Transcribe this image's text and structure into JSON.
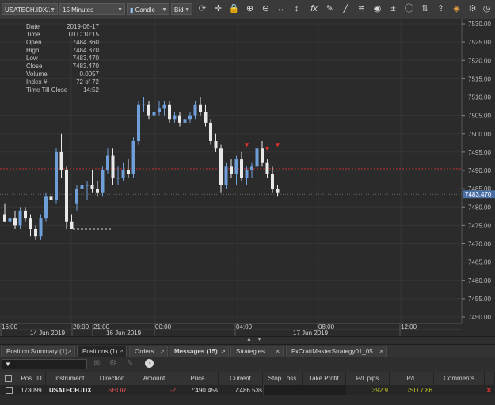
{
  "toolbar": {
    "instrument": "USATECH.IDX/...",
    "timeframe": "15 Minutes",
    "chart_type": "Candle",
    "price_side": "Bid",
    "icons": [
      "refresh-icon",
      "crosshair-icon",
      "lock-icon",
      "zoom-in-icon",
      "zoom-out-icon",
      "horizontal-arrows-icon",
      "vertical-arrows-icon",
      "function-icon",
      "pencil-icon",
      "diagonal-line-icon",
      "layers-icon",
      "eye-icon",
      "plus-minus-icon",
      "info-icon",
      "sell-buy-icon",
      "export-icon",
      "paint-icon",
      "settings-icon"
    ]
  },
  "info_panel": [
    {
      "key": "Date",
      "value": "2019-06-17"
    },
    {
      "key": "Time",
      "value": "UTC 10:15"
    },
    {
      "key": "Open",
      "value": "7484.360"
    },
    {
      "key": "High",
      "value": "7484.370"
    },
    {
      "key": "Low",
      "value": "7483.470"
    },
    {
      "key": "Close",
      "value": "7483.470"
    },
    {
      "key": "Volume",
      "value": "0.0057"
    },
    {
      "key": "Index #",
      "value": "72 of 72"
    },
    {
      "key": "Time Till Close",
      "value": "14:52"
    }
  ],
  "chart_data": {
    "type": "candlestick",
    "ylim": [
      7445,
      7532
    ],
    "y_ticks": [
      "7530.00",
      "7525.00",
      "7520.00",
      "7515.00",
      "7510.00",
      "7505.00",
      "7500.00",
      "7495.00",
      "7490.00",
      "7485.00",
      "7480.00",
      "7475.00",
      "7470.00",
      "7465.00",
      "7460.00",
      "7455.00",
      "7450.00"
    ],
    "current_price_label": "7483.470",
    "position_entry_price": 7490.45,
    "candles_ohlc": [
      [
        7478,
        7481,
        7476,
        7476
      ],
      [
        7476,
        7480,
        7474,
        7477
      ],
      [
        7477,
        7479,
        7474,
        7475
      ],
      [
        7475,
        7480,
        7474,
        7479
      ],
      [
        7479,
        7480,
        7476,
        7477
      ],
      [
        7477,
        7478,
        7472,
        7474
      ],
      [
        7474,
        7475,
        7471,
        7472
      ],
      [
        7472,
        7478,
        7471,
        7477
      ],
      [
        7477,
        7484,
        7476,
        7483
      ],
      [
        7483,
        7490,
        7479,
        7482
      ],
      [
        7482,
        7496,
        7481,
        7495
      ],
      [
        7495,
        7500,
        7488,
        7490
      ],
      [
        7490,
        7491,
        7474,
        7476
      ],
      [
        7476,
        7478,
        7474,
        7474
      ],
      [
        7481,
        7486,
        7479,
        7485
      ],
      [
        7485,
        7488,
        7483,
        7486
      ],
      [
        7486,
        7487,
        7482,
        7486
      ],
      [
        7486,
        7490,
        7484,
        7485
      ],
      [
        7485,
        7487,
        7483,
        7484
      ],
      [
        7484,
        7491,
        7483,
        7490
      ],
      [
        7490,
        7496,
        7489,
        7494
      ],
      [
        7494,
        7496,
        7486,
        7488
      ],
      [
        7488,
        7491,
        7486,
        7488
      ],
      [
        7488,
        7492,
        7487,
        7490
      ],
      [
        7490,
        7493,
        7488,
        7489
      ],
      [
        7489,
        7499,
        7488,
        7498
      ],
      [
        7498,
        7509,
        7497,
        7508
      ],
      [
        7508,
        7510,
        7506,
        7508
      ],
      [
        7508,
        7509,
        7504,
        7505
      ],
      [
        7505,
        7508,
        7503,
        7506
      ],
      [
        7506,
        7509,
        7505,
        7507
      ],
      [
        7507,
        7509,
        7505,
        7508
      ],
      [
        7508,
        7509,
        7503,
        7504
      ],
      [
        7504,
        7506,
        7503,
        7505
      ],
      [
        7505,
        7506,
        7502,
        7503
      ],
      [
        7503,
        7505,
        7502,
        7504
      ],
      [
        7504,
        7506,
        7503,
        7505
      ],
      [
        7505,
        7509,
        7504,
        7508
      ],
      [
        7508,
        7510,
        7505,
        7506
      ],
      [
        7506,
        7508,
        7502,
        7503
      ],
      [
        7503,
        7504,
        7497,
        7498
      ],
      [
        7498,
        7500,
        7495,
        7496
      ],
      [
        7496,
        7497,
        7484,
        7486
      ],
      [
        7486,
        7492,
        7485,
        7491
      ],
      [
        7491,
        7493,
        7488,
        7489
      ],
      [
        7489,
        7494,
        7486,
        7493
      ],
      [
        7493,
        7495,
        7487,
        7488
      ],
      [
        7488,
        7491,
        7486,
        7490
      ],
      [
        7490,
        7492,
        7488,
        7491
      ],
      [
        7491,
        7497,
        7490,
        7496
      ],
      [
        7496,
        7498,
        7491,
        7492
      ],
      [
        7492,
        7493,
        7488,
        7489
      ],
      [
        7489,
        7491,
        7484,
        7485
      ],
      [
        7485,
        7486,
        7483,
        7484
      ]
    ],
    "x_labels_row1": [
      "16:00",
      "20:00",
      "21:00",
      "00:00",
      "04:00",
      "08:00",
      "12:00"
    ],
    "x_labels_row2": [
      "14 Jun 2019",
      "16 Jun 2019",
      "17 Jun 2019"
    ]
  },
  "tabs": [
    {
      "label": "Position Summary (1)",
      "active": false
    },
    {
      "label": "Positions (1)",
      "active": true
    },
    {
      "label": "Orders",
      "active": false
    },
    {
      "label": "Messages (15)",
      "active": false
    },
    {
      "label": "Strategies",
      "active": false
    },
    {
      "label": "FxCraftMasterStrategy01_05",
      "active": false
    }
  ],
  "columns": [
    "Pos. ID",
    "Instrument",
    "Direction",
    "Amount",
    "Price",
    "Current",
    "Stop Loss",
    "Take Profit",
    "P/L pips",
    "P/L",
    "Comments"
  ],
  "row": {
    "pos_id": "173099...",
    "instrument": "USATECH.IDX",
    "direction": "SHORT",
    "amount": "-2",
    "price": "7'490.45s",
    "current": "7'486.53s",
    "stop_loss": "",
    "take_profit": "",
    "pl_pips": "392.9",
    "pl": "USD 7.86",
    "comments": ""
  },
  "colors": {
    "short": "#e05050",
    "profit": "#c8d020",
    "bull_candle": "#6f9fd8",
    "bear_candle": "#e8e8e8",
    "entry_line": "#c03030"
  }
}
